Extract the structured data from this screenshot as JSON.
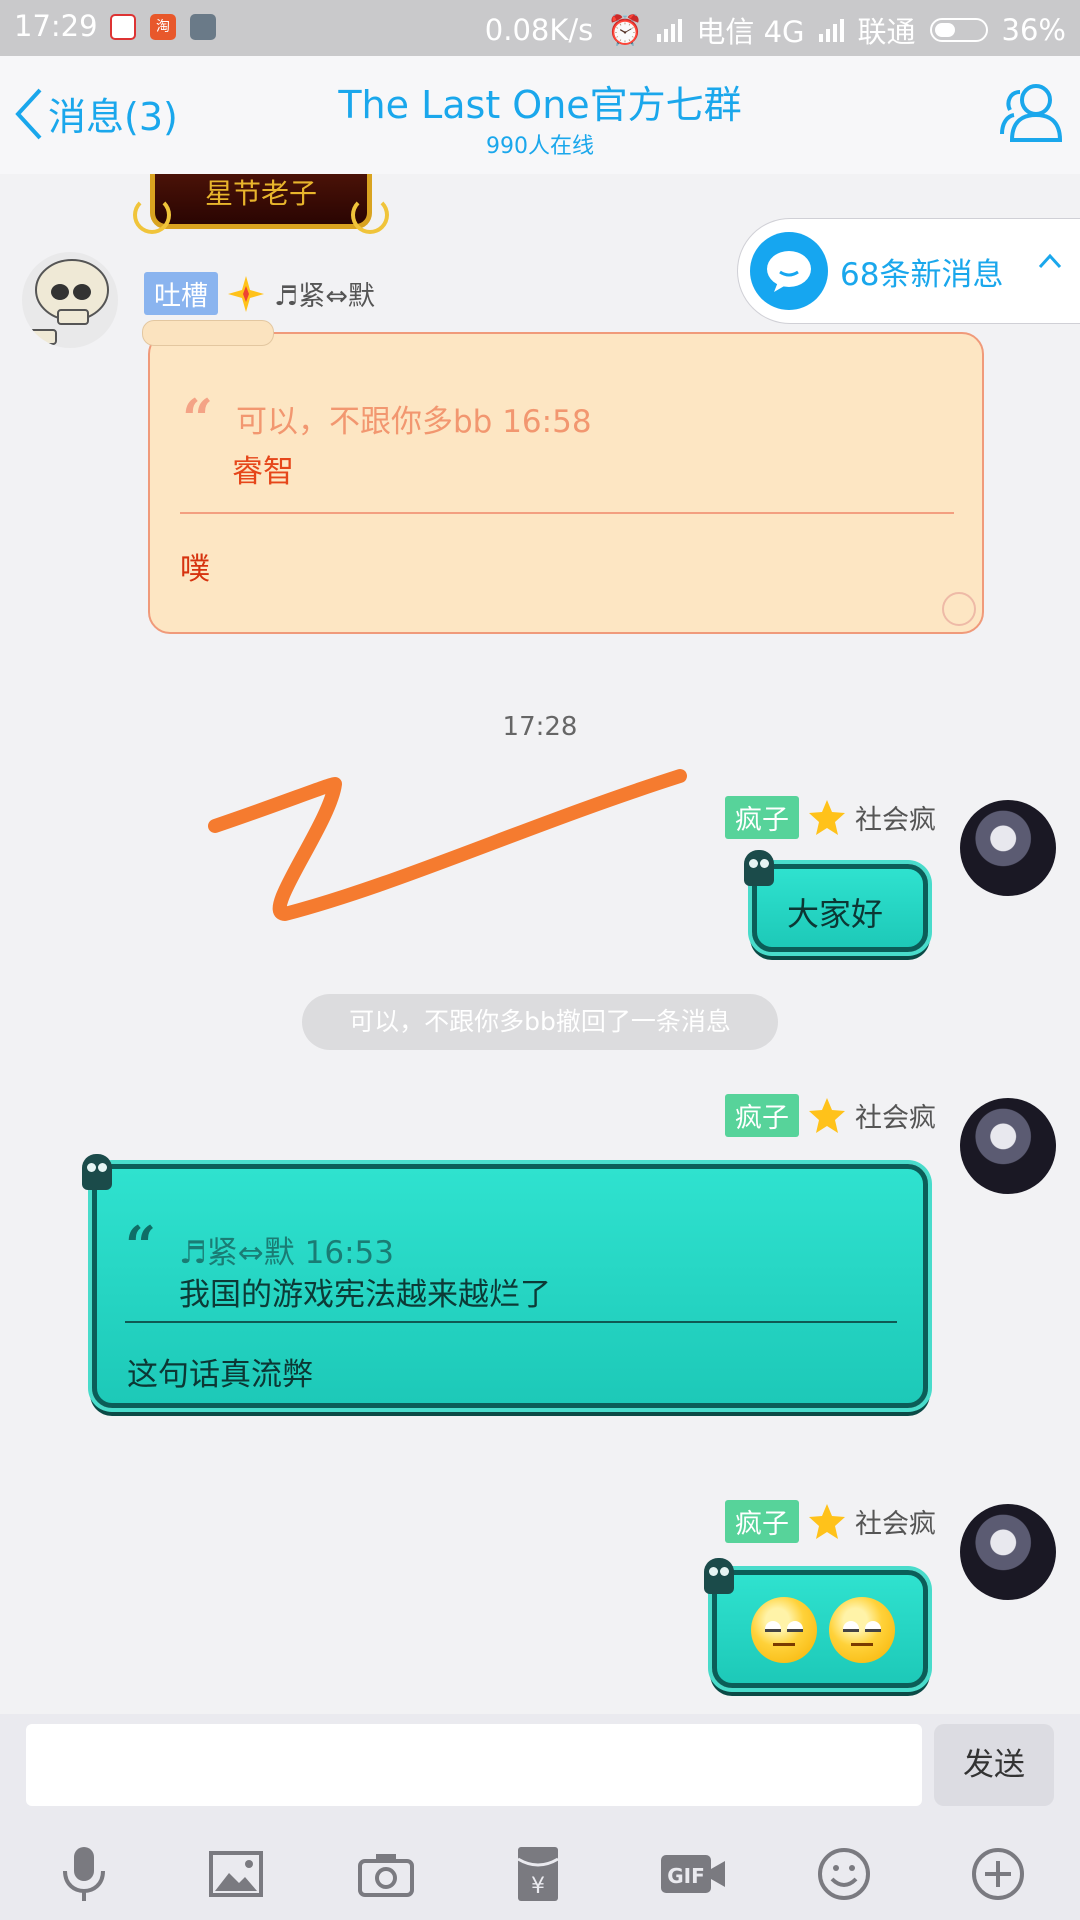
{
  "status_bar": {
    "time": "17:29",
    "speed": "0.08K/s",
    "carrier1": "电信 4G",
    "carrier2": "联通",
    "battery": "36%",
    "app_badge_b": "淘"
  },
  "header": {
    "back_label": "消息(3)",
    "title": "The Last One官方七群",
    "subtitle": "990人在线"
  },
  "new_messages": {
    "label": "68条新消息"
  },
  "plaque": {
    "text": "星节老子"
  },
  "messages": [
    {
      "tag": "吐槽",
      "sender": "♬紧⇔默",
      "quote_head": "可以，不跟你多bb 16:58",
      "quote_body": "睿智",
      "reply": "噗"
    }
  ],
  "timestamp": "17:28",
  "msg_hello": {
    "tag": "疯子",
    "sender": "社会疯",
    "text": "大家好"
  },
  "recall": {
    "text": "可以，不跟你多bb撤回了一条消息"
  },
  "msg_quote": {
    "tag": "疯子",
    "sender": "社会疯",
    "quote_head": "♬紧⇔默 16:53",
    "quote_body": "我国的游戏宪法越来越烂了",
    "reply": "这句话真流弊"
  },
  "msg_emoji": {
    "tag": "疯子",
    "sender": "社会疯"
  },
  "input": {
    "placeholder": "",
    "send_label": "发送"
  },
  "colors": {
    "accent": "#1aa7ec",
    "teal": "#1fcdbb",
    "parchment": "#fde6c3",
    "scribble": "#f57b2f"
  },
  "toolbar_icons": [
    "mic-icon",
    "image-icon",
    "camera-icon",
    "red-packet-icon",
    "gif-icon",
    "emoji-icon",
    "plus-icon"
  ]
}
